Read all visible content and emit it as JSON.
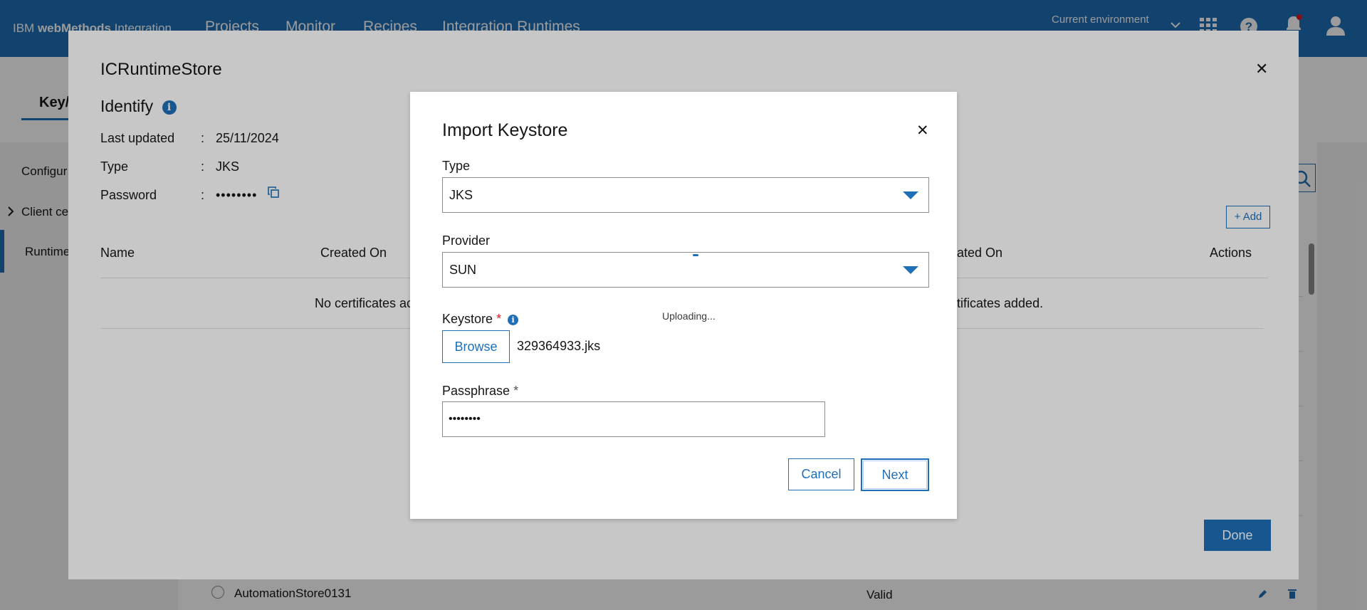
{
  "topnav": {
    "brand_prefix": "IBM ",
    "brand_name": "webMethods",
    "brand_suffix": " Integration",
    "items": [
      "Projects",
      "Monitor",
      "Recipes",
      "Integration Runtimes"
    ],
    "environment_label": "Current environment",
    "icons": [
      "chevron-down-icon",
      "app-grid-icon",
      "help-icon",
      "notification-icon",
      "user-avatar-icon"
    ],
    "notification_dot_color": "#da1e28"
  },
  "background": {
    "tab_label": "Key/",
    "sidebar": [
      "Configur",
      "Client ce",
      "Runtime"
    ],
    "row_name": "AutomationStore0131",
    "row_status": "Valid"
  },
  "store_modal": {
    "title": "ICRuntimeStore",
    "section": "Identify",
    "fields": [
      {
        "label": "Last updated",
        "value": "25/11/2024"
      },
      {
        "label": "Type",
        "value": "JKS"
      },
      {
        "label": "Password",
        "value": "••••••••"
      }
    ],
    "colon": ":",
    "add_label": "+ Add",
    "columns": [
      "Name",
      "Created On",
      "ated On",
      "Actions"
    ],
    "empty_left": "No certificates ac",
    "empty_right": "ertificates added.",
    "done_label": "Done"
  },
  "import_modal": {
    "title": "Import Keystore",
    "type_label": "Type",
    "type_value": "JKS",
    "provider_label": "Provider",
    "provider_value": "SUN",
    "keystore_label": "Keystore",
    "required_mark": "*",
    "browse_label": "Browse",
    "file_name": "329364933.jks",
    "uploading_text": "Uploading...",
    "passphrase_label": "Passphrase",
    "passphrase_value": "••••••••",
    "cancel_label": "Cancel",
    "next_label": "Next"
  },
  "colors": {
    "brand_blue": "#1f6fb8",
    "required_red": "#da1e28"
  }
}
